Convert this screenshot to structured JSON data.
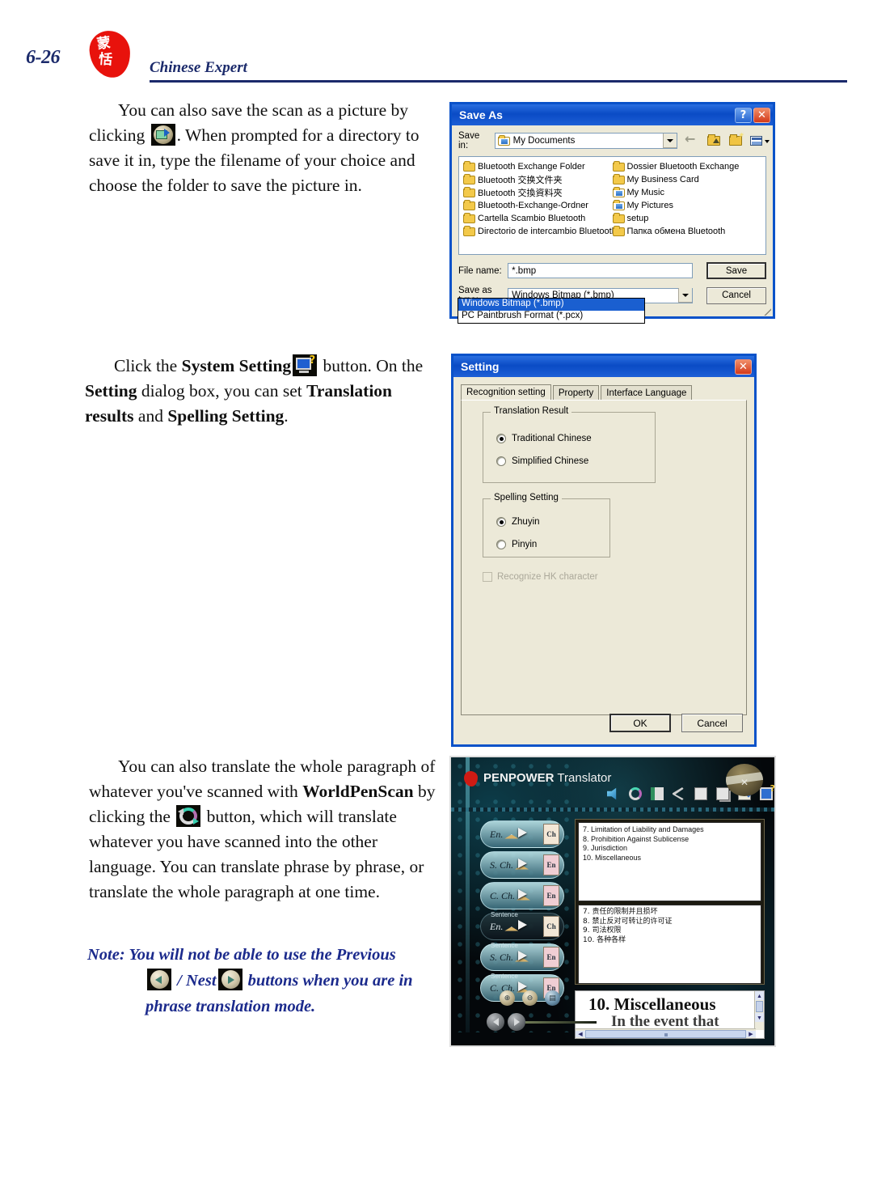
{
  "header": {
    "page_number": "6-26",
    "title": "Chinese Expert",
    "seal_glyph_1": "蒙",
    "seal_glyph_2": "恬"
  },
  "body": {
    "para1": {
      "t1": "You can also save the scan as a picture by clicking ",
      "icon": "save-picture-icon",
      "t2": ". When prompted for a directory to save it in, type the filename of your choice and choose the folder to save the picture in."
    },
    "para2": {
      "t1": "Click the ",
      "b1": "System Setting",
      "icon": "system-setting-icon",
      "t2": " button. On the ",
      "b2": "Setting",
      "t3": " dialog box, you can set ",
      "b3": "Translation results",
      "t4": " and ",
      "b4": "Spelling Setting",
      "t5": "."
    },
    "para3": {
      "t1": "You can also translate the whole paragraph of whatever you've scanned with ",
      "b1": "WorldPenScan",
      "t2": " by clicking the ",
      "icon": "translate-icon",
      "t3": " button, which will translate whatever you have scanned into the other language. You can translate phrase by phrase, or translate the whole paragraph at one time."
    },
    "note": {
      "label": "Note:",
      "t1": " You will not be able to use the ",
      "b1": "Previous",
      "icon_prev": "previous-button-icon",
      "sep": " / ",
      "b2": "Nest",
      "icon_next": "next-button-icon",
      "t2": " buttons when you are in phrase translation mode."
    }
  },
  "save_as_dialog": {
    "title": "Save As",
    "help_button": "?",
    "close_button": "✕",
    "save_in_label": "Save in:",
    "save_in_value": "My Documents",
    "toolbar_icons": [
      "back-icon",
      "up-one-level-icon",
      "new-folder-icon",
      "views-icon"
    ],
    "files_col1": [
      "Bluetooth Exchange Folder",
      "Bluetooth 交换文件夹",
      "Bluetooth 交換資料夾",
      "Bluetooth-Exchange-Ordner",
      "Cartella Scambio Bluetooth",
      "Directorio de intercambio Bluetooth"
    ],
    "files_col2": [
      "Dossier Bluetooth Exchange",
      "My Business Card",
      "My Music",
      "My Pictures",
      "setup",
      "Папка обмена Bluetooth"
    ],
    "file_name_label": "File name:",
    "file_name_value": "*.bmp",
    "save_as_type_label": "Save as type:",
    "save_as_type_value": "Windows Bitmap (*.bmp)",
    "type_options": [
      "Windows Bitmap (*.bmp)",
      "PC Paintbrush Format (*.pcx)"
    ],
    "type_selected_index": 0,
    "save_button": "Save",
    "cancel_button": "Cancel"
  },
  "setting_dialog": {
    "title": "Setting",
    "close_button": "✕",
    "tabs": [
      {
        "label": "Recognition setting",
        "active": true
      },
      {
        "label": "Property",
        "active": false
      },
      {
        "label": "Interface Language",
        "active": false
      }
    ],
    "translation_result": {
      "legend": "Translation Result",
      "options": [
        {
          "label": "Traditional Chinese",
          "selected": true
        },
        {
          "label": "Simplified Chinese",
          "selected": false
        }
      ]
    },
    "spelling_setting": {
      "legend": "Spelling Setting",
      "options": [
        {
          "label": "Zhuyin",
          "selected": true
        },
        {
          "label": "Pinyin",
          "selected": false
        }
      ]
    },
    "hk_checkbox": {
      "label": "Recognize HK character",
      "checked": false,
      "disabled": true
    },
    "ok_button": "OK",
    "cancel_button": "Cancel"
  },
  "penpower": {
    "brand_bold": "PENPOWER",
    "brand_rest": " Translator",
    "toolbar_icons": [
      "speak-icon",
      "translate-icon",
      "word-list-icon",
      "scissors-icon",
      "copy-icon",
      "paste-icon",
      "save-picture-icon",
      "system-setting-icon"
    ],
    "direction_buttons": [
      {
        "tag": "",
        "from": "En.",
        "to": "Ch",
        "style": "light"
      },
      {
        "tag": "",
        "from": "S. Ch.",
        "to": "En",
        "style": "light"
      },
      {
        "tag": "",
        "from": "C. Ch.",
        "to": "En",
        "style": "light"
      },
      {
        "tag": "Sentence",
        "from": "En.",
        "to": "Ch",
        "style": "dark"
      },
      {
        "tag": "Sentence",
        "from": "S. Ch.",
        "to": "En",
        "style": "light"
      },
      {
        "tag": "Sentence",
        "from": "C. Ch.",
        "to": "En",
        "style": "light"
      }
    ],
    "source_pane_lines": [
      "7. Limitation of Liability and Damages",
      "8. Prohibition Against Sublicense",
      "9. Jurisdiction",
      "10. Miscellaneous"
    ],
    "target_pane_lines": [
      "7. 责任的限制并且损坏",
      "8. 禁止反对可转让的许可证",
      "9. 司法权限",
      "10. 各种各样"
    ],
    "doc_view": {
      "heading": "10. Miscellaneous",
      "subline": "In the event that"
    },
    "nav_buttons": [
      {
        "name": "zoom-in-button",
        "glyph": "⊕"
      },
      {
        "name": "zoom-out-button",
        "glyph": "⊖"
      },
      {
        "name": "open-file-button",
        "glyph": "▤"
      }
    ],
    "prev_button": "previous-button",
    "next_button": "next-button"
  },
  "colors": {
    "brand_blue": "#1b2a6b",
    "seal_red": "#e8120c",
    "dialog_titlebar": "#0a4bc5",
    "dialog_face": "#ece9d8",
    "note_blue": "#1b2a8c"
  }
}
